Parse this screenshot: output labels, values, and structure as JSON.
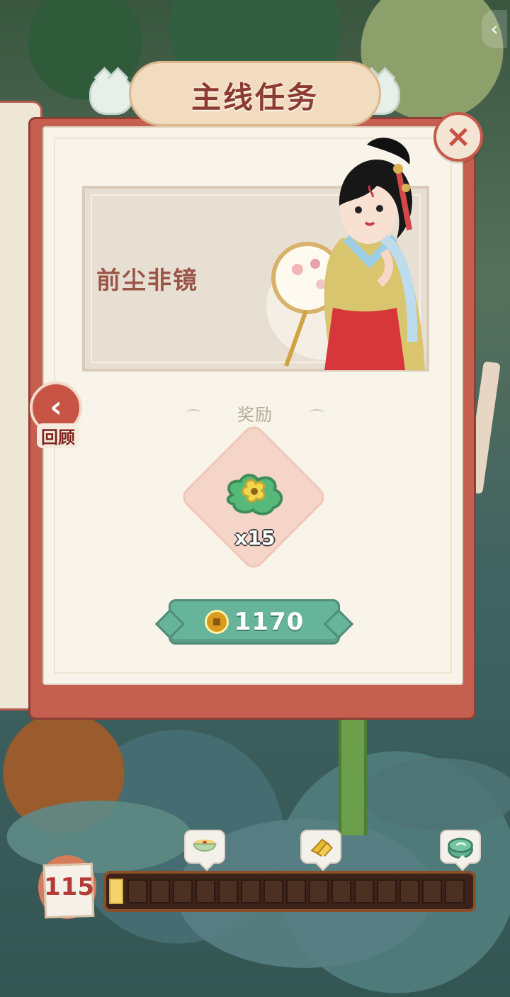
{
  "header": {
    "title": "主线任务"
  },
  "quest": {
    "name": "前尘非镜"
  },
  "navigation": {
    "review_label": "回顾"
  },
  "reward": {
    "title": "奖励",
    "quantity": "x15"
  },
  "purchase": {
    "price": "1170"
  },
  "calendar": {
    "day": "115"
  },
  "colors": {
    "accent_red": "#c55f4f",
    "accent_green": "#66b49a",
    "paper": "#f8f4ea"
  },
  "icons": {
    "back": "chevron-left",
    "close": "x",
    "review": "chevron-left",
    "reward": "green-jade-pendant",
    "currency": "coin",
    "milestones": [
      "bowl",
      "gold-leaf",
      "green-jade-pendant"
    ]
  },
  "progress": {
    "fill_fraction": 0.025
  }
}
